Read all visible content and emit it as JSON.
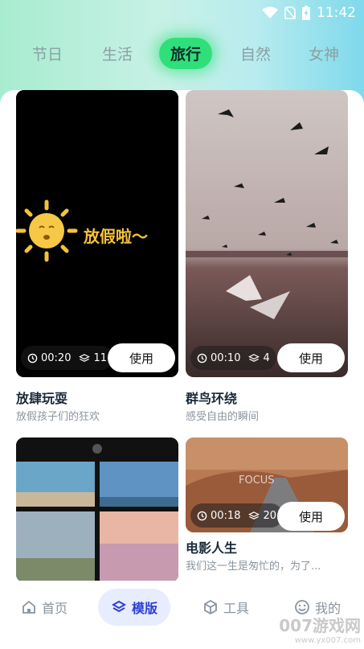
{
  "status_bar": {
    "time": "11:42"
  },
  "tabs": [
    {
      "label": "节日",
      "active": false
    },
    {
      "label": "生活",
      "active": false
    },
    {
      "label": "旅行",
      "active": true
    },
    {
      "label": "自然",
      "active": false
    },
    {
      "label": "女神",
      "active": false
    }
  ],
  "cards": [
    {
      "overlay_text": "放假啦～",
      "duration": "00:20",
      "layers": "11",
      "use_label": "使用",
      "title": "放肆玩耍",
      "subtitle": "放假孩子们的狂欢"
    },
    {
      "duration": "00:10",
      "layers": "4",
      "use_label": "使用",
      "title": "群鸟环绕",
      "subtitle": "感受自由的瞬间"
    },
    {
      "duration": "",
      "layers": "",
      "use_label": "",
      "title": "",
      "subtitle": ""
    },
    {
      "overlay_text": "FOCUS",
      "duration": "00:18",
      "layers": "20",
      "use_label": "使用",
      "title": "电影人生",
      "subtitle": "我们这一生是匆忙的，为了..."
    }
  ],
  "nav": [
    {
      "label": "首页",
      "icon": "home-icon",
      "active": false
    },
    {
      "label": "模版",
      "icon": "layers-icon",
      "active": true
    },
    {
      "label": "工具",
      "icon": "cube-icon",
      "active": false
    },
    {
      "label": "我的",
      "icon": "smile-icon",
      "active": false
    }
  ],
  "watermark": {
    "text": "007游戏网",
    "url": "www.yx007.com"
  },
  "colors": {
    "accent_green": "#2fe07a",
    "nav_active_bg": "#e8ecff",
    "nav_active_text": "#2c3fd9"
  }
}
